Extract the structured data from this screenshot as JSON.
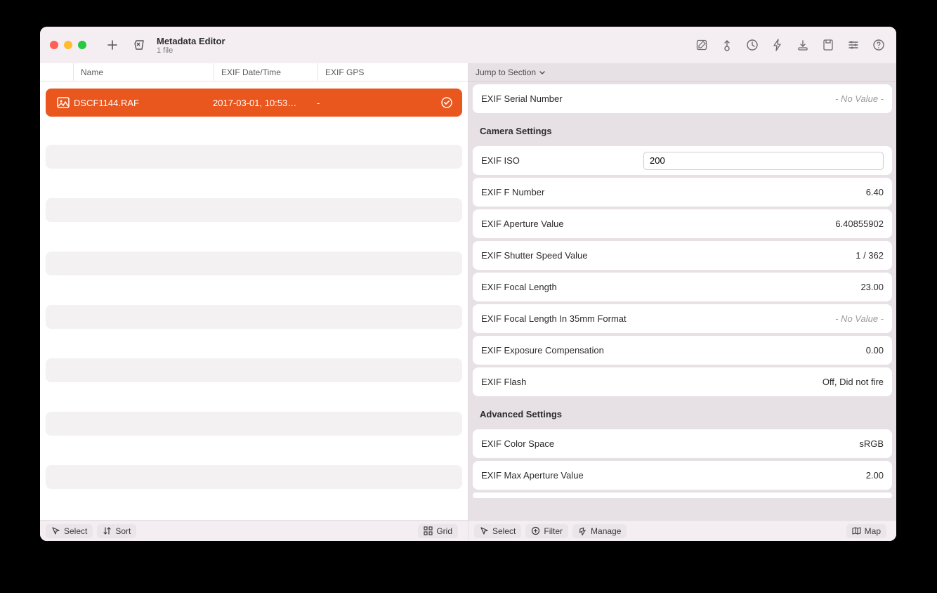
{
  "window": {
    "title": "Metadata Editor",
    "subtitle": "1 file"
  },
  "columns": {
    "name": "Name",
    "date": "EXIF Date/Time",
    "gps": "EXIF GPS"
  },
  "file": {
    "name": "DSCF1144.RAF",
    "date": "2017-03-01, 10:53…",
    "gps": "-"
  },
  "jump": {
    "label": "Jump to Section"
  },
  "novalue": "- No Value -",
  "details": {
    "serial": {
      "label": "EXIF Serial Number"
    },
    "section_camera": "Camera Settings",
    "iso": {
      "label": "EXIF ISO",
      "value": "200"
    },
    "fnumber": {
      "label": "EXIF F Number",
      "value": "6.40"
    },
    "aperture": {
      "label": "EXIF Aperture Value",
      "value": "6.40855902"
    },
    "shutter": {
      "label": "EXIF Shutter Speed Value",
      "value": "1 / 362"
    },
    "focal": {
      "label": "EXIF Focal Length",
      "value": "23.00"
    },
    "focal35": {
      "label": "EXIF Focal Length In 35mm Format"
    },
    "expcomp": {
      "label": "EXIF Exposure Compensation",
      "value": "0.00"
    },
    "flash": {
      "label": "EXIF Flash",
      "value": "Off, Did not fire"
    },
    "section_advanced": "Advanced Settings",
    "colorspace": {
      "label": "EXIF Color Space",
      "value": "sRGB"
    },
    "maxaperture": {
      "label": "EXIF Max Aperture Value",
      "value": "2.00"
    }
  },
  "footer": {
    "select": "Select",
    "sort": "Sort",
    "grid": "Grid",
    "filter": "Filter",
    "manage": "Manage",
    "map": "Map"
  }
}
